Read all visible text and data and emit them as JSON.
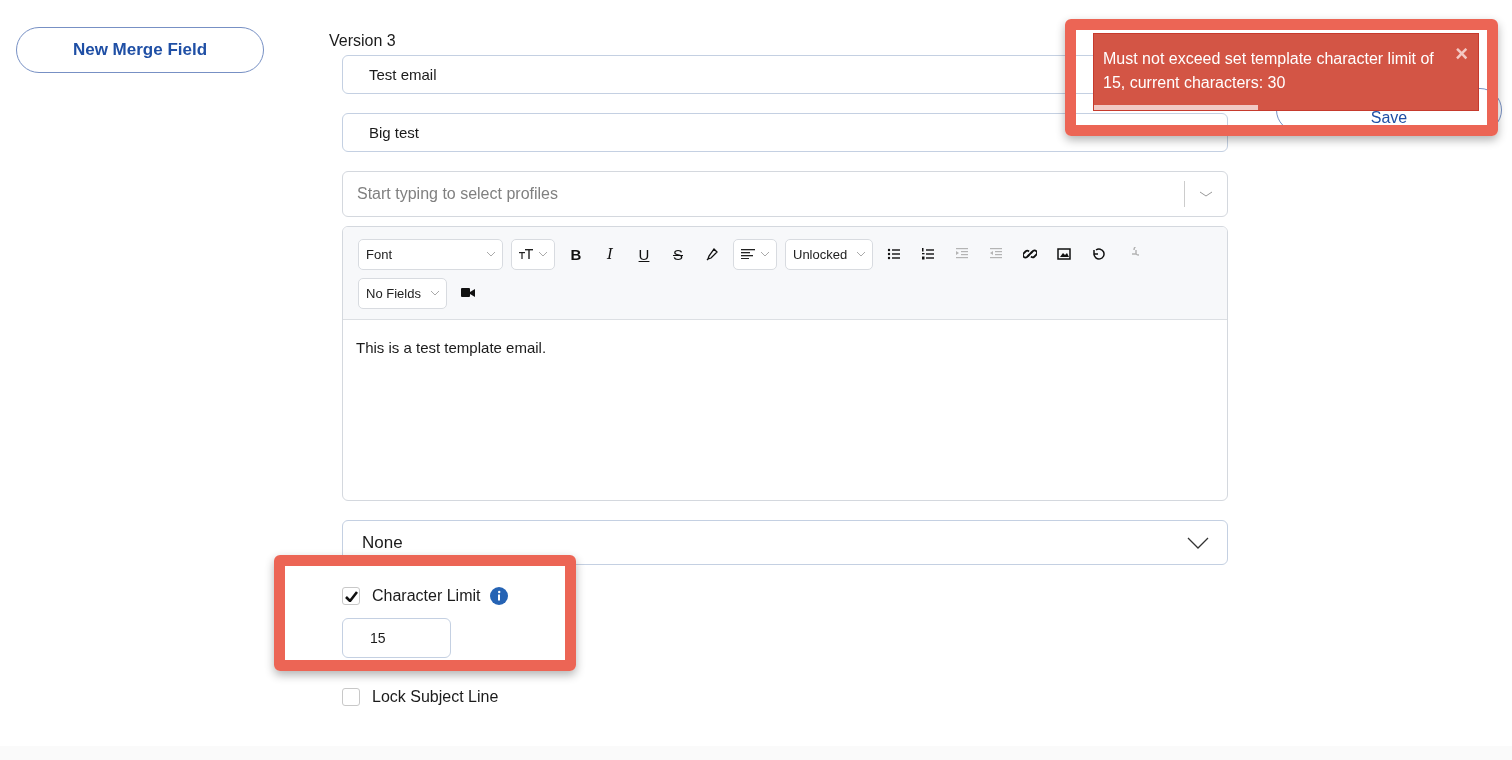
{
  "sidebar": {
    "new_button": "New Merge Field"
  },
  "form": {
    "version_label": "Version 3",
    "name_field": {
      "value": "Test email"
    },
    "subject_field": {
      "value": "Big test"
    },
    "profiles_select": {
      "placeholder": "Start typing to select profiles"
    },
    "editor": {
      "toolbar": [
        {
          "kind": "select",
          "label": "Font"
        },
        {
          "kind": "icon-select"
        },
        {
          "kind": "letter",
          "label": "B",
          "disabled": false
        },
        {
          "kind": "letter",
          "label": "I",
          "disabled": false
        },
        {
          "kind": "letter",
          "label": "U",
          "disabled": false
        },
        {
          "kind": "letter",
          "label": "S",
          "disabled": false
        },
        {
          "kind": "icon",
          "disabled": false
        },
        {
          "kind": "icon-select"
        },
        {
          "kind": "select",
          "label": "Unlocked"
        },
        {
          "kind": "icon",
          "disabled": false
        },
        {
          "kind": "icon",
          "disabled": false
        },
        {
          "kind": "icon",
          "disabled": true
        },
        {
          "kind": "icon",
          "disabled": true
        },
        {
          "kind": "icon",
          "disabled": false
        },
        {
          "kind": "icon",
          "disabled": false
        },
        {
          "kind": "icon",
          "disabled": false
        },
        {
          "kind": "icon",
          "disabled": true
        },
        {
          "kind": "break"
        },
        {
          "kind": "select",
          "label": "No Fields"
        },
        {
          "kind": "icon",
          "disabled": false
        }
      ],
      "body": "This is a test template email."
    },
    "type_select": {
      "value": "None"
    },
    "character_limit": {
      "label": "Character Limit",
      "checked": true,
      "value": "15"
    },
    "lock_subject": {
      "label": "Lock Subject Line",
      "checked": false
    }
  },
  "actions": {
    "save_button": "Save"
  },
  "toast": {
    "message": "Must not exceed set template character limit of 15, current characters: 30",
    "close": "×"
  }
}
